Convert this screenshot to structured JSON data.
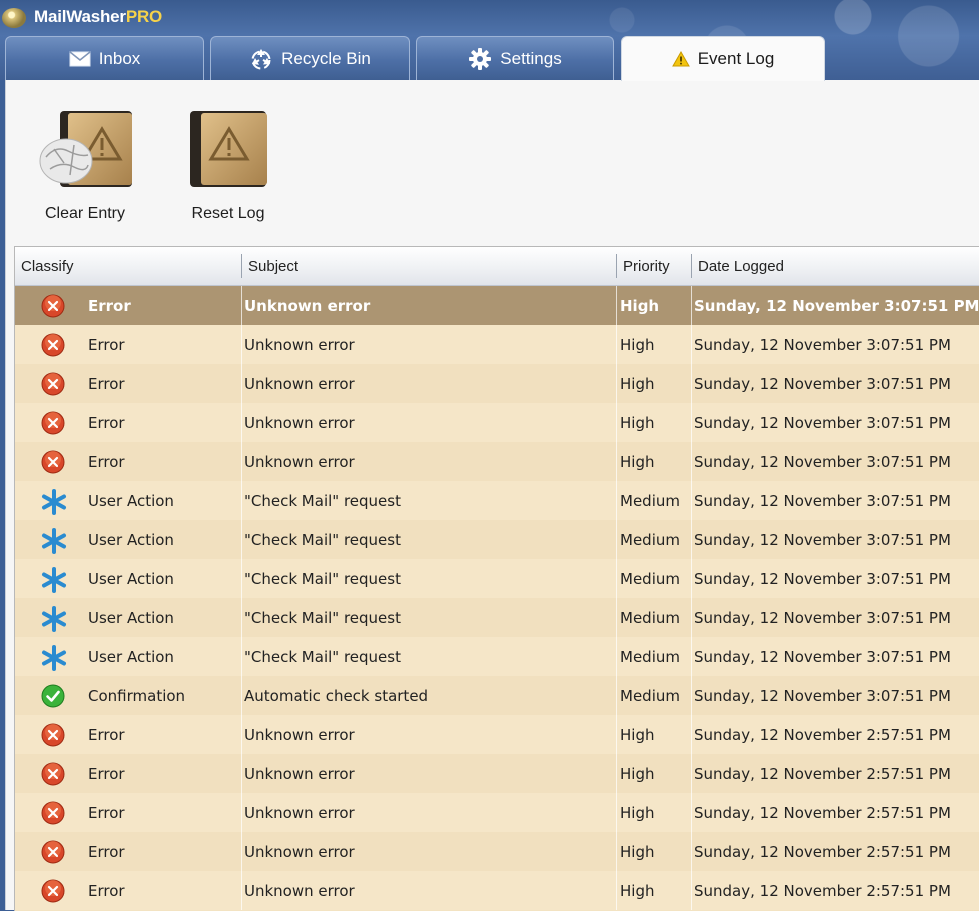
{
  "app": {
    "title_part1": "MailWasher",
    "title_part2": "PRO"
  },
  "tabs": [
    {
      "label": "Inbox",
      "icon": "envelope-icon"
    },
    {
      "label": "Recycle Bin",
      "icon": "recycle-icon"
    },
    {
      "label": "Settings",
      "icon": "gear-icon"
    },
    {
      "label": "Event Log",
      "icon": "warning-icon",
      "active": true
    }
  ],
  "toolbar": {
    "clear_label": "Clear Entry",
    "reset_label": "Reset Log"
  },
  "table": {
    "columns": [
      "Classify",
      "Subject",
      "Priority",
      "Date Logged"
    ],
    "rows": [
      {
        "type": "error",
        "classify": "Error",
        "subject": "Unknown error",
        "priority": "High",
        "date": "Sunday, 12 November 3:07:51 PM",
        "selected": true
      },
      {
        "type": "error",
        "classify": "Error",
        "subject": "Unknown error",
        "priority": "High",
        "date": "Sunday, 12 November 3:07:51 PM"
      },
      {
        "type": "error",
        "classify": "Error",
        "subject": "Unknown error",
        "priority": "High",
        "date": "Sunday, 12 November 3:07:51 PM"
      },
      {
        "type": "error",
        "classify": "Error",
        "subject": "Unknown error",
        "priority": "High",
        "date": "Sunday, 12 November 3:07:51 PM"
      },
      {
        "type": "error",
        "classify": "Error",
        "subject": "Unknown error",
        "priority": "High",
        "date": "Sunday, 12 November 3:07:51 PM"
      },
      {
        "type": "action",
        "classify": "User Action",
        "subject": "\"Check Mail\" request",
        "priority": "Medium",
        "date": "Sunday, 12 November 3:07:51 PM"
      },
      {
        "type": "action",
        "classify": "User Action",
        "subject": "\"Check Mail\" request",
        "priority": "Medium",
        "date": "Sunday, 12 November 3:07:51 PM"
      },
      {
        "type": "action",
        "classify": "User Action",
        "subject": "\"Check Mail\" request",
        "priority": "Medium",
        "date": "Sunday, 12 November 3:07:51 PM"
      },
      {
        "type": "action",
        "classify": "User Action",
        "subject": "\"Check Mail\" request",
        "priority": "Medium",
        "date": "Sunday, 12 November 3:07:51 PM"
      },
      {
        "type": "action",
        "classify": "User Action",
        "subject": "\"Check Mail\" request",
        "priority": "Medium",
        "date": "Sunday, 12 November 3:07:51 PM"
      },
      {
        "type": "confirm",
        "classify": "Confirmation",
        "subject": "Automatic check started",
        "priority": "Medium",
        "date": "Sunday, 12 November 3:07:51 PM"
      },
      {
        "type": "error",
        "classify": "Error",
        "subject": "Unknown error",
        "priority": "High",
        "date": "Sunday, 12 November 2:57:51 PM"
      },
      {
        "type": "error",
        "classify": "Error",
        "subject": "Unknown error",
        "priority": "High",
        "date": "Sunday, 12 November 2:57:51 PM"
      },
      {
        "type": "error",
        "classify": "Error",
        "subject": "Unknown error",
        "priority": "High",
        "date": "Sunday, 12 November 2:57:51 PM"
      },
      {
        "type": "error",
        "classify": "Error",
        "subject": "Unknown error",
        "priority": "High",
        "date": "Sunday, 12 November 2:57:51 PM"
      },
      {
        "type": "error",
        "classify": "Error",
        "subject": "Unknown error",
        "priority": "High",
        "date": "Sunday, 12 November 2:57:51 PM"
      }
    ]
  },
  "colors": {
    "selected_row": "#ac9572",
    "row_even": "#f1e0bf",
    "row_odd": "#f5e6c8",
    "title_accent": "#f6d24a"
  }
}
